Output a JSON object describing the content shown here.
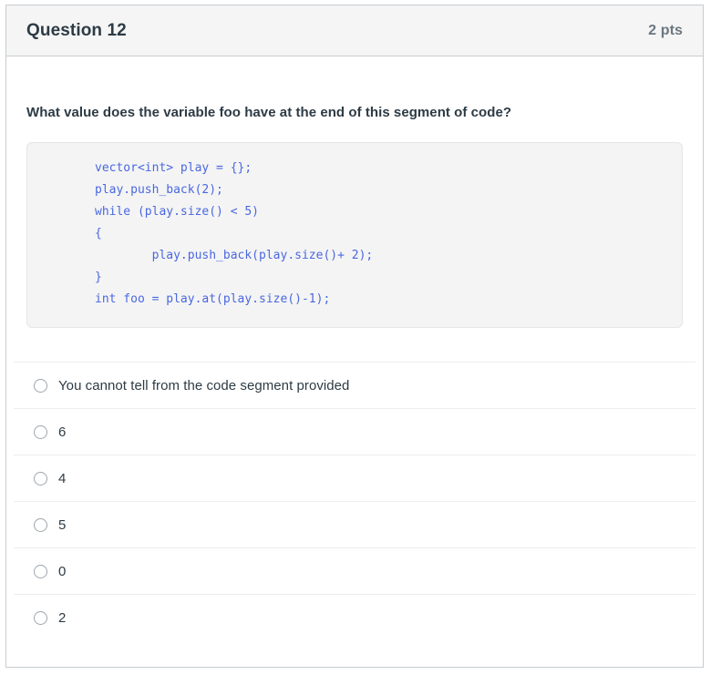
{
  "header": {
    "question_name": "Question 12",
    "points": "2 pts"
  },
  "question": {
    "prompt": "What value does the variable foo have at the end of this segment of code?",
    "code_lines": [
      "vector<int> play = {};",
      "play.push_back(2);",
      "while (play.size() < 5)",
      "{",
      "        play.push_back(play.size()+ 2);",
      "}",
      "int foo = play.at(play.size()-1);"
    ],
    "answers": [
      {
        "label": "You cannot tell from the code segment provided",
        "selected": false
      },
      {
        "label": "6",
        "selected": false
      },
      {
        "label": "4",
        "selected": false
      },
      {
        "label": "5",
        "selected": false
      },
      {
        "label": "0",
        "selected": false
      },
      {
        "label": "2",
        "selected": false
      }
    ]
  },
  "colors": {
    "header_background": "#f5f5f5",
    "border": "#c7cdd1",
    "code_background": "#f4f4f4",
    "code_text": "#4a68e0",
    "text": "#2d3b45",
    "muted_text": "#6b7780",
    "separator": "#ededee"
  }
}
